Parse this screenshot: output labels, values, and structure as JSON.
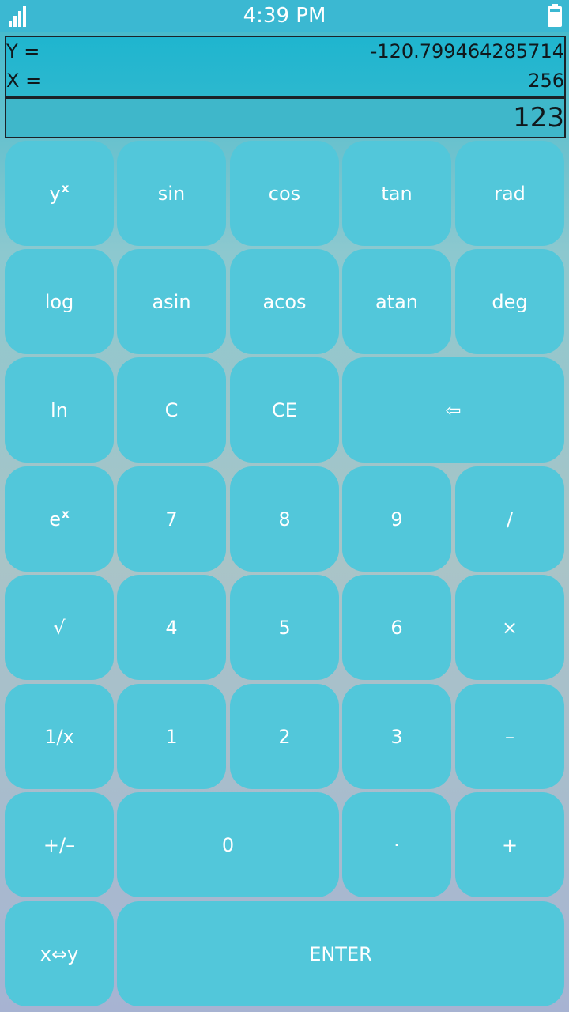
{
  "status_bar": {
    "time": "4:39 PM",
    "signal_icon": "cellular-signal-icon",
    "battery_icon": "battery-icon"
  },
  "colors": {
    "status_bar_bg": "#3bb8d2",
    "key_bg": "#52c7da",
    "key_text": "#ffffff",
    "display_text": "#10181c"
  },
  "display": {
    "y_label": "Y =",
    "y_value": "-120.799464285714",
    "x_label": "X =",
    "x_value": "256",
    "entry_value": "123"
  },
  "keys": {
    "power": {
      "base": "y",
      "exp": "x"
    },
    "sin": "sin",
    "cos": "cos",
    "tan": "tan",
    "rad": "rad",
    "log": "log",
    "asin": "asin",
    "acos": "acos",
    "atan": "atan",
    "deg": "deg",
    "ln": "ln",
    "clear": "C",
    "clear_entry": "CE",
    "backspace": "⇦",
    "exp": {
      "base": "e",
      "exp": "x"
    },
    "seven": "7",
    "eight": "8",
    "nine": "9",
    "divide": "/",
    "sqrt": "√",
    "four": "4",
    "five": "5",
    "six": "6",
    "multiply": "×",
    "reciprocal": "1/x",
    "one": "1",
    "two": "2",
    "three": "3",
    "minus": "–",
    "negate": "+/–",
    "zero": "0",
    "decimal": "·",
    "plus": "+",
    "swap": "x⇔y",
    "enter": "ENTER"
  }
}
